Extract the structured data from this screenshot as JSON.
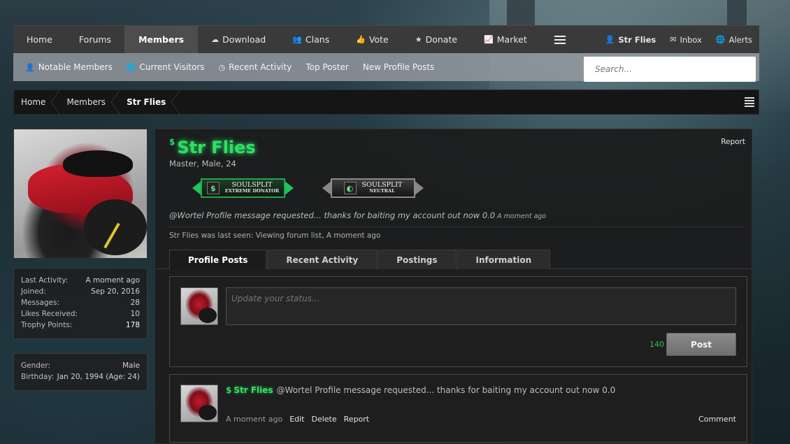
{
  "nav": {
    "items": [
      {
        "label": "Home",
        "icon": ""
      },
      {
        "label": "Forums",
        "icon": ""
      },
      {
        "label": "Members",
        "icon": ""
      },
      {
        "label": "Download",
        "icon": "cloud-download-icon"
      },
      {
        "label": "Clans",
        "icon": "users-icon"
      },
      {
        "label": "Vote",
        "icon": "thumbs-up-icon"
      },
      {
        "label": "Donate",
        "icon": "star-icon"
      },
      {
        "label": "Market",
        "icon": "line-chart-icon"
      }
    ],
    "active": "Members",
    "user_label": "Str Flies",
    "inbox_label": "Inbox",
    "alerts_label": "Alerts"
  },
  "subnav": {
    "items": [
      "Notable Members",
      "Current Visitors",
      "Recent Activity",
      "Top Poster",
      "New Profile Posts"
    ],
    "search_placeholder": "Search..."
  },
  "breadcrumb": [
    "Home",
    "Members",
    "Str Flies"
  ],
  "sidebar": {
    "stats": [
      {
        "k": "Last Activity:",
        "v": "A moment ago"
      },
      {
        "k": "Joined:",
        "v": "Sep 20, 2016"
      },
      {
        "k": "Messages:",
        "v": "28"
      },
      {
        "k": "Likes Received:",
        "v": "10"
      },
      {
        "k": "Trophy Points:",
        "v": "178"
      }
    ],
    "info": [
      {
        "k": "Gender:",
        "v": "Male"
      },
      {
        "k": "Birthday:",
        "v": "Jan 20, 1994 (Age: 24)"
      }
    ]
  },
  "profile": {
    "report": "Report",
    "username": "Str Flies",
    "user_title": "Master, Male, 24",
    "badges": [
      {
        "line1": "SOULSPLIT",
        "line2": "EXTREME DONATOR",
        "color": "#23c35b"
      },
      {
        "line1": "SOULSPLIT",
        "line2": "NEUTRAL",
        "color": "#888888"
      }
    ],
    "status": "@Wortel Profile message requested... thanks for baiting my account out now 0.0",
    "status_time": "A moment ago",
    "last_seen": "Str Flies was last seen: Viewing forum list, A moment ago",
    "tabs": [
      "Profile Posts",
      "Recent Activity",
      "Postings",
      "Information"
    ],
    "active_tab": "Profile Posts"
  },
  "composer": {
    "placeholder": "Update your status...",
    "char_count": "140",
    "post_label": "Post"
  },
  "message": {
    "author": "Str Flies",
    "text": "@Wortel Profile message requested... thanks for baiting my account out now 0.0",
    "time": "A moment ago",
    "edit": "Edit",
    "delete": "Delete",
    "report": "Report",
    "comment": "Comment"
  },
  "colors": {
    "accent_green": "#2ee063",
    "nav_bg": "#3a3a3a",
    "subnav_bg": "#969ba0"
  }
}
